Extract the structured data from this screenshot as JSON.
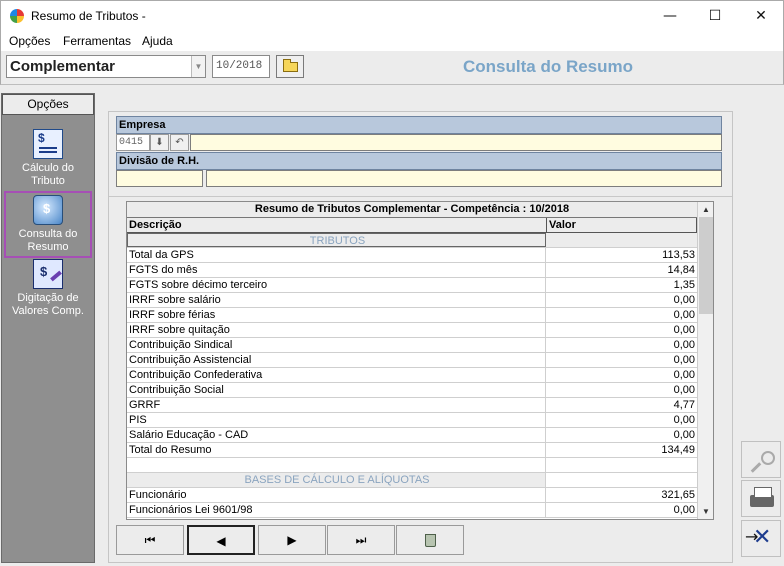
{
  "window": {
    "title": "Resumo de Tributos -",
    "min": "—",
    "max": "☐",
    "close": "✕"
  },
  "menu": [
    "Opções",
    "Ferramentas",
    "Ajuda"
  ],
  "toolbar": {
    "type_value": "Complementar",
    "period": "10/2018",
    "heading": "Consulta do Resumo"
  },
  "sidebar": {
    "header": "Opções",
    "items": [
      {
        "label": "Cálculo do Tributo",
        "icon": "calculation-icon"
      },
      {
        "label": "Consulta do Resumo",
        "icon": "consult-icon",
        "active": true
      },
      {
        "label": "Digitação de Valores Comp.",
        "icon": "entry-icon"
      }
    ]
  },
  "form": {
    "empresa_label": "Empresa",
    "empresa_code": "0415",
    "divisao_label": "Divisão de R.H."
  },
  "grid": {
    "title": "Resumo de Tributos Complementar - Competência : 10/2018",
    "col_desc": "Descrição",
    "col_value": "Valor",
    "rows": [
      {
        "d": "TRIBUTOS",
        "v": "",
        "section": true
      },
      {
        "d": "Total da GPS",
        "v": "113,53"
      },
      {
        "d": "FGTS do mês",
        "v": "14,84"
      },
      {
        "d": "FGTS sobre décimo terceiro",
        "v": "1,35"
      },
      {
        "d": "IRRF sobre salário",
        "v": "0,00"
      },
      {
        "d": "IRRF sobre férias",
        "v": "0,00"
      },
      {
        "d": "IRRF sobre quitação",
        "v": "0,00"
      },
      {
        "d": "Contribuição Sindical",
        "v": "0,00"
      },
      {
        "d": "Contribuição Assistencial",
        "v": "0,00"
      },
      {
        "d": "Contribuição Confederativa",
        "v": "0,00"
      },
      {
        "d": "Contribuição Social",
        "v": "0,00"
      },
      {
        "d": "GRRF",
        "v": "4,77"
      },
      {
        "d": "PIS",
        "v": "0,00"
      },
      {
        "d": "Salário Educação - CAD",
        "v": "0,00"
      },
      {
        "d": "Total do Resumo",
        "v": "134,49"
      },
      {
        "d": "",
        "v": ""
      },
      {
        "d": "BASES DE CÁLCULO E ALÍQUOTAS",
        "v": "",
        "section2": true
      },
      {
        "d": "Funcionário",
        "v": "321,65"
      },
      {
        "d": "Funcionários Lei 9601/98",
        "v": "0,00"
      }
    ]
  },
  "nav": {
    "first": "⏮",
    "prev": "◀",
    "next": "▶",
    "last": "⏭"
  }
}
